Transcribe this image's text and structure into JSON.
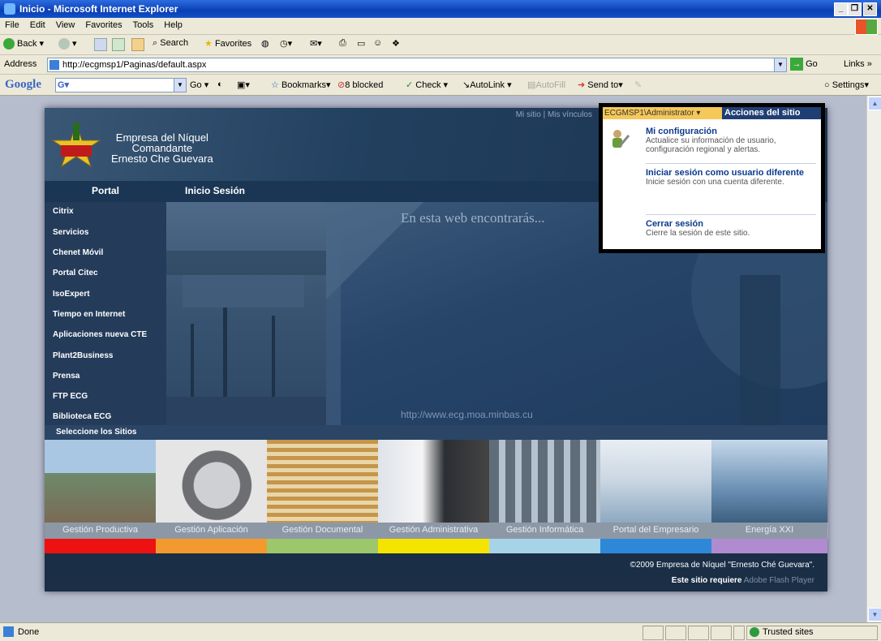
{
  "window": {
    "title": "Inicio - Microsoft Internet Explorer"
  },
  "menu": {
    "items": [
      "File",
      "Edit",
      "View",
      "Favorites",
      "Tools",
      "Help"
    ]
  },
  "toolbar": {
    "back": "Back",
    "search": "Search",
    "favorites": "Favorites"
  },
  "address": {
    "label": "Address",
    "url": "http://ecgmsp1/Paginas/default.aspx",
    "go": "Go",
    "links": "Links"
  },
  "googlebar": {
    "logo": "Google",
    "go": "Go",
    "bookmarks": "Bookmarks",
    "blocked": "8 blocked",
    "check": "Check",
    "autolink": "AutoLink",
    "autofill": "AutoFill",
    "sendto": "Send to",
    "settings": "Settings"
  },
  "page": {
    "toplinks": "Mi sitio | Mis vínculos",
    "company": [
      "Empresa del Níquel",
      "Comandante",
      "Ernesto Che Guevara"
    ],
    "nav": [
      "Portal",
      "Inicio Sesión"
    ],
    "sidebar": [
      "Citrix",
      "Servicios",
      "Chenet Móvil",
      "Portal Citec",
      "IsoExpert",
      "Tiempo en Internet",
      "Aplicaciones nueva CTE",
      "Plant2Business",
      "Prensa",
      "FTP ECG",
      "Biblioteca ECG"
    ],
    "banner_text": "En esta web encontrarás...",
    "banner_url": "http://www.ecg.moa.minbas.cu",
    "sites_label": "Seleccione los Sitios",
    "tiles": [
      {
        "label": "Gestión Productiva",
        "color": "#ee1111"
      },
      {
        "label": "Gestión Aplicación",
        "color": "#f39a2e"
      },
      {
        "label": "Gestión Documental",
        "color": "#9cc76a"
      },
      {
        "label": "Gestión Administrativa",
        "color": "#f5e400"
      },
      {
        "label": "Gestión Informática",
        "color": "#a7d3e8"
      },
      {
        "label": "Portal del Empresario",
        "color": "#2e88d8"
      },
      {
        "label": "Energía XXI",
        "color": "#b08bd0"
      }
    ],
    "footer_copyright": "©2009 Empresa de Níquel \"Ernesto Ché Guevara\".",
    "footer_requires": "Este sitio requiere",
    "footer_flash": "Adobe Flash Player"
  },
  "dropdown": {
    "user": "ECGMSP1\\Administrator",
    "actions": "Acciones del sitio",
    "items": [
      {
        "title": "Mi configuración",
        "desc": "Actualice su información de usuario, configuración regional y alertas."
      },
      {
        "title": "Iniciar sesión como usuario diferente",
        "desc": "Inicie sesión con una cuenta diferente."
      },
      {
        "title": "Cerrar sesión",
        "desc": "Cierre la sesión de este sitio."
      }
    ]
  },
  "status": {
    "text": "Done",
    "zone": "Trusted sites"
  }
}
